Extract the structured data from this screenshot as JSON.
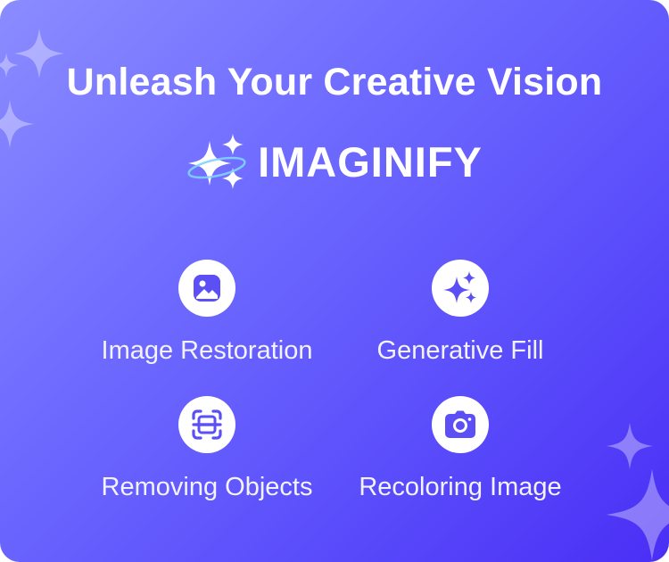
{
  "headline": "Unleash Your Creative Vision",
  "brand": {
    "name": "IMAGINIFY",
    "logo_icon": "sparkle-logo-icon"
  },
  "features": [
    {
      "label": "Image Restoration",
      "icon": "image-icon"
    },
    {
      "label": "Generative Fill",
      "icon": "sparkles-icon"
    },
    {
      "label": "Removing Objects",
      "icon": "scan-icon"
    },
    {
      "label": "Recoloring Image",
      "icon": "camera-icon"
    }
  ],
  "colors": {
    "gradient_start": "#8b8cff",
    "gradient_end": "#4a2ef5",
    "icon_fill": "#5b4ff5",
    "text": "#ffffff"
  }
}
